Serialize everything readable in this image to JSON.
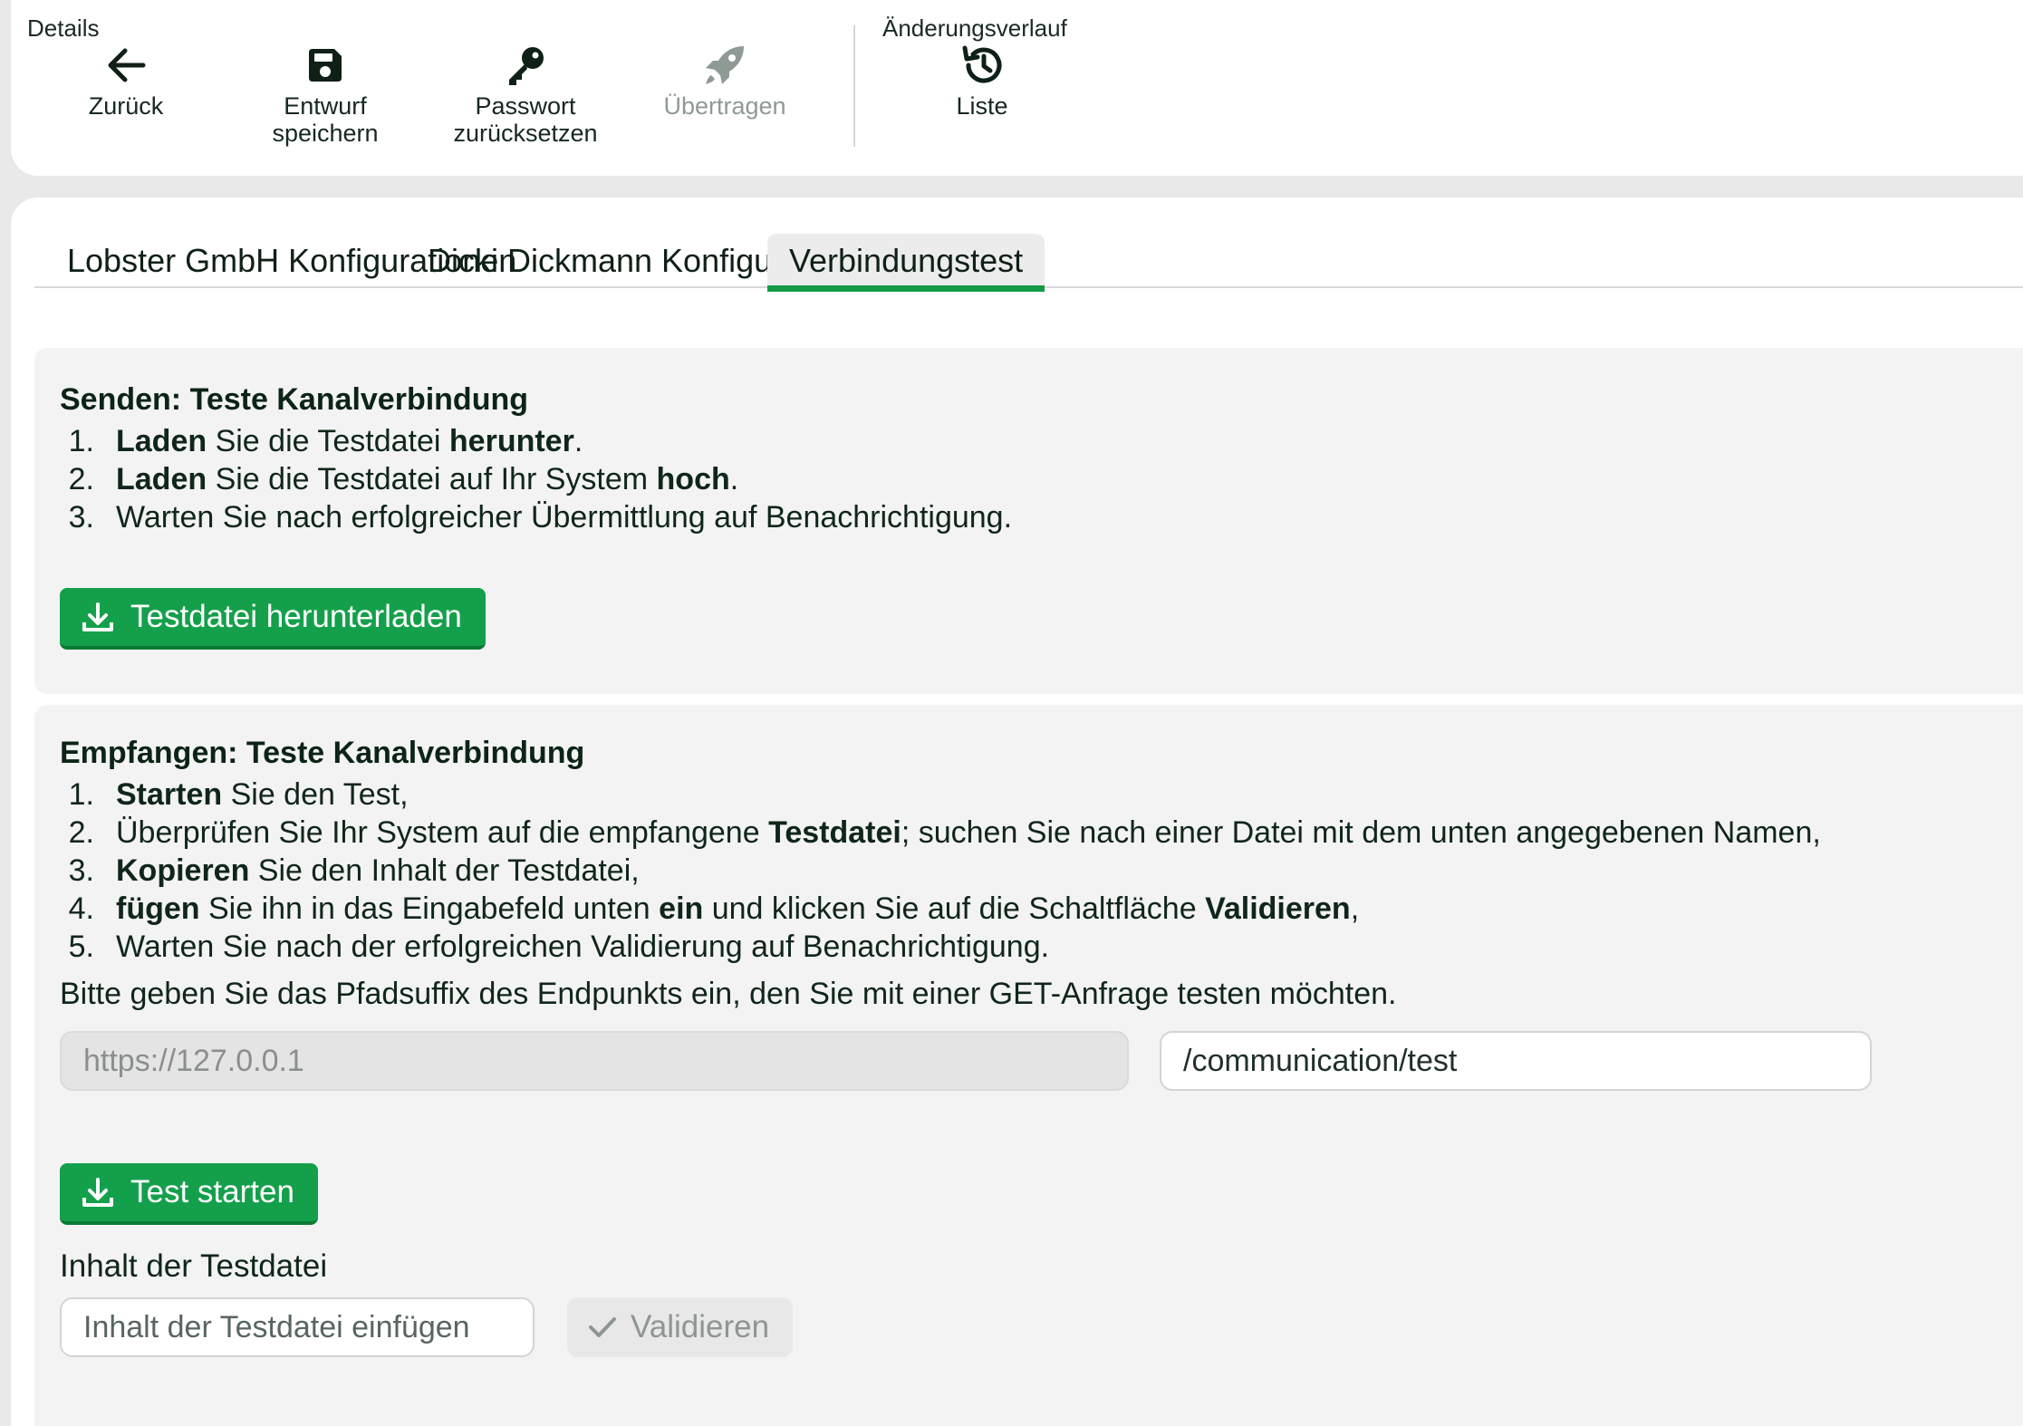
{
  "toolbar": {
    "details_label": "Details",
    "history_label": "Änderungsverlauf",
    "back": "Zurück",
    "save_line1": "Entwurf",
    "save_line2": "speichern",
    "reset_line1": "Passwort",
    "reset_line2": "zurücksetzen",
    "transfer": "Übertragen",
    "list": "Liste"
  },
  "tabs": [
    {
      "label": "Lobster GmbH Konfigurationen"
    },
    {
      "label": "Dicki Dickmann Konfigurationen"
    },
    {
      "label": "Verbindungstest",
      "active": true
    }
  ],
  "send": {
    "title": "Senden: Teste Kanalverbindung",
    "steps": [
      {
        "num": "1.",
        "parts": [
          {
            "b": "Laden"
          },
          {
            "t": " Sie die Testdatei "
          },
          {
            "b": "herunter"
          },
          {
            "t": "."
          }
        ]
      },
      {
        "num": "2.",
        "parts": [
          {
            "b": "Laden"
          },
          {
            "t": " Sie die Testdatei auf Ihr System "
          },
          {
            "b": "hoch"
          },
          {
            "t": "."
          }
        ]
      },
      {
        "num": "3.",
        "parts": [
          {
            "t": "Warten Sie nach erfolgreicher Übermittlung auf Benachrichtigung."
          }
        ]
      }
    ],
    "download_button": "Testdatei herunterladen"
  },
  "receive": {
    "title": "Empfangen: Teste Kanalverbindung",
    "steps": [
      {
        "num": "1.",
        "parts": [
          {
            "b": "Starten"
          },
          {
            "t": " Sie den Test,"
          }
        ]
      },
      {
        "num": "2.",
        "parts": [
          {
            "t": "Überprüfen Sie Ihr System auf die empfangene "
          },
          {
            "b": "Testdatei"
          },
          {
            "t": "; suchen Sie nach einer Datei mit dem unten angegebenen Namen,"
          }
        ]
      },
      {
        "num": "3.",
        "parts": [
          {
            "b": "Kopieren"
          },
          {
            "t": " Sie den Inhalt der Testdatei,"
          }
        ]
      },
      {
        "num": "4.",
        "parts": [
          {
            "b": "fügen"
          },
          {
            "t": " Sie ihn in das Eingabefeld unten "
          },
          {
            "b": "ein"
          },
          {
            "t": " und klicken Sie auf die Schaltfläche "
          },
          {
            "b": "Validieren"
          },
          {
            "t": ","
          }
        ]
      },
      {
        "num": "5.",
        "parts": [
          {
            "t": "Warten Sie nach der erfolgreichen Validierung auf Benachrichtigung."
          }
        ]
      }
    ],
    "hint": "Bitte geben Sie das Pfadsuffix des Endpunkts ein, den Sie mit einer GET-Anfrage testen möchten.",
    "base_url": "https://127.0.0.1",
    "path_suffix": "/communication/test",
    "start_button": "Test starten",
    "content_label": "Inhalt der Testdatei",
    "content_placeholder": "Inhalt der Testdatei einfügen",
    "validate_button": "Validieren"
  },
  "colors": {
    "accent": "#14a04b",
    "disabled_text": "#8d9690"
  }
}
